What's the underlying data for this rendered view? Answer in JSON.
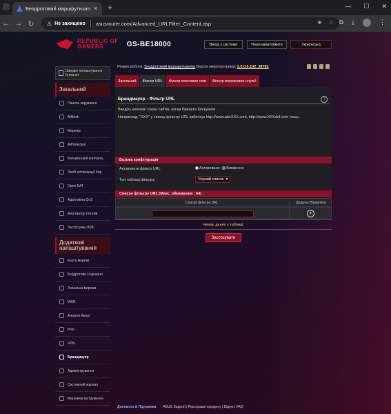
{
  "browser": {
    "tab_title": "Бездротовий маршрутизатор A",
    "url_warning": "Не захищено",
    "url": "asusrouter.com/Advanced_URLFilter_Content.asp"
  },
  "header": {
    "brand_line1": "REPUBLIC OF",
    "brand_line2": "GAMERS",
    "model": "GS-BE18000",
    "logout": "Вихід з системи",
    "reboot": "Перезавантажити",
    "language": "Українська"
  },
  "status": {
    "mode_label": "Режим роботи:",
    "mode_value": "Бездротовий маршрутизатор",
    "fw_label": "Версія мікропрограми:",
    "fw_value": "3.0.0.6.102_38782"
  },
  "sidebar": {
    "qis": "Швидке налаштування Інтернет",
    "general": "Загальний",
    "general_items": [
      {
        "label": "Панель керування",
        "icon": "dashboard-icon"
      },
      {
        "label": "AiMesh",
        "icon": "mesh-icon"
      },
      {
        "label": "Мережа",
        "icon": "network-icon"
      },
      {
        "label": "AiProtection",
        "icon": "shield-icon"
      },
      {
        "label": "Батьківський контроль",
        "icon": "parental-icon"
      },
      {
        "label": "Засіб оптимізації Ігор",
        "icon": "game-icon"
      },
      {
        "label": "Open NAT",
        "icon": "nat-icon"
      },
      {
        "label": "Адаптивна QoS",
        "icon": "qos-icon"
      },
      {
        "label": "Аналізатор потоків",
        "icon": "traffic-icon"
      },
      {
        "label": "Застосунки USB",
        "icon": "usb-icon"
      }
    ],
    "advanced": "Додаткові налаштування",
    "advanced_items": [
      {
        "label": "Карта мережі",
        "icon": "map-icon"
      },
      {
        "label": "Бездротове з'єднання",
        "icon": "wifi-icon"
      },
      {
        "label": "Локальна мережа",
        "icon": "lan-icon"
      },
      {
        "label": "WAN",
        "icon": "wan-icon"
      },
      {
        "label": "Amazon Alexa",
        "icon": "alexa-icon"
      },
      {
        "label": "IPv6",
        "icon": "ipv6-icon"
      },
      {
        "label": "VPN",
        "icon": "vpn-icon"
      },
      {
        "label": "Брандмауер",
        "icon": "firewall-icon",
        "active": true
      },
      {
        "label": "Адміністрування",
        "icon": "admin-icon"
      },
      {
        "label": "Системний журнал",
        "icon": "log-icon"
      },
      {
        "label": "Мережеві інструменти",
        "icon": "tools-icon"
      }
    ]
  },
  "tabs": [
    "Загальний",
    "Фільтр URL",
    "Фільтр ключових слів",
    "Фільтр мережевих служб"
  ],
  "main": {
    "title": "Брандмауер - Фільтр URL",
    "desc1": "Введіть ключові слова сайтів, які ви бажаєте блокувати.",
    "desc2": "Наприклад, \"XXX\" у списку фільтру URL заблокує http://www.abcXXX.com, http://www.XXXdef.com тощо.",
    "basic_config": "Базова конфігурація",
    "enable_label": "Активувати фільтр URL",
    "opt_on": "Активовано",
    "opt_off": "Вимкнено",
    "table_type_label": "Тип таблиці фільтру:",
    "table_type_value": "Чорний список",
    "list_header": "Список фільтру URL (Макс. обмеження : 64)",
    "col_url": "Список фільтра URL:",
    "col_action": "Додати / Видалити",
    "no_data": "Немає даних у таблиці.",
    "apply": "Застосувати"
  },
  "footer": {
    "help": "Допомога & Підтримка",
    "links": "ASUS Support | Реєстрація продукту | Відгук | FAQ"
  }
}
